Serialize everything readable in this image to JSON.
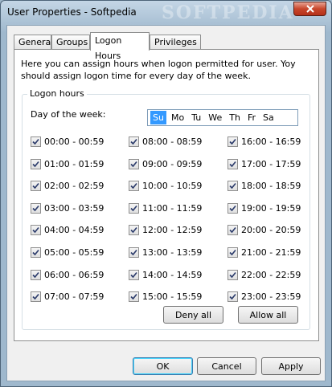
{
  "window": {
    "title": "User Properties - Softpedia",
    "watermark": "SOFTPEDIA"
  },
  "tabs": [
    {
      "label": "General"
    },
    {
      "label": "Groups"
    },
    {
      "label": "Logon Hours",
      "active": true
    },
    {
      "label": "Privileges"
    }
  ],
  "panel": {
    "description": "Here you can assign hours when logon permitted for user. Yoy should assign logon time for every day of the week.",
    "group_label": "Logon hours",
    "dow_label": "Day of the week:",
    "days": [
      "Su",
      "Mo",
      "Tu",
      "We",
      "Th",
      "Fr",
      "Sa"
    ],
    "selected_day": "Su",
    "hours": [
      "00:00 - 00:59",
      "01:00 - 01:59",
      "02:00 - 02:59",
      "03:00 - 03:59",
      "04:00 - 04:59",
      "05:00 - 05:59",
      "06:00 - 06:59",
      "07:00 - 07:59",
      "08:00 - 08:59",
      "09:00 - 09:59",
      "10:00 - 10:59",
      "11:00 - 11:59",
      "12:00 - 12:59",
      "13:00 - 13:59",
      "14:00 - 14:59",
      "15:00 - 15:59",
      "16:00 - 16:59",
      "17:00 - 17:59",
      "18:00 - 18:59",
      "19:00 - 19:59",
      "20:00 - 20:59",
      "21:00 - 21:59",
      "22:00 - 22:59",
      "23:00 - 23:59"
    ],
    "deny_all_label": "Deny all",
    "allow_all_label": "Allow all"
  },
  "footer": {
    "ok_label": "OK",
    "cancel_label": "Cancel",
    "apply_label": "Apply"
  },
  "colors": {
    "selected_day_bg": "#3399ff",
    "close_button": "#c8462c"
  }
}
